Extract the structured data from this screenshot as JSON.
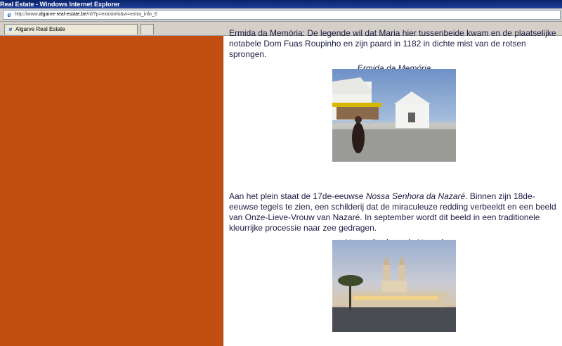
{
  "window": {
    "title": "Real Estate - Windows Internet Explorer"
  },
  "address_bar": {
    "url_prefix": "http://www.",
    "url_domain": "algarve-real-estate.be",
    "url_suffix": "/nl/?p=extrainfo&w=extra_info_6"
  },
  "tabs": [
    {
      "label": "Algarve Real Estate"
    }
  ],
  "content": {
    "paragraph1": "Ermida da Memória: De legende wil dat Maria hier tussenbeide kwam en de plaatselijke notabele Dom Fuas Roupinho en zijn paard in 1182 in dichte mist van de rotsen sprongen.",
    "caption1": "Ermida da Memória",
    "paragraph2_a": "Aan het plein staat de 17de-eeuwse ",
    "paragraph2_em": "Nossa Senhora da Nazaré",
    "paragraph2_b": ". Binnen zijn 18de-eeuwse tegels te zien, een schilderij dat de miraculeuze redding verbeeldt en een beeld van Onze-Lieve-Vrouw van Nazaré. In september wordt dit beeld in een traditionele kleurrijke processie naar zee gedragen.",
    "caption2": "Nossa Senhora da Nazaré"
  },
  "colors": {
    "sidebar": "#c24e12",
    "text": "#1c1c44"
  }
}
